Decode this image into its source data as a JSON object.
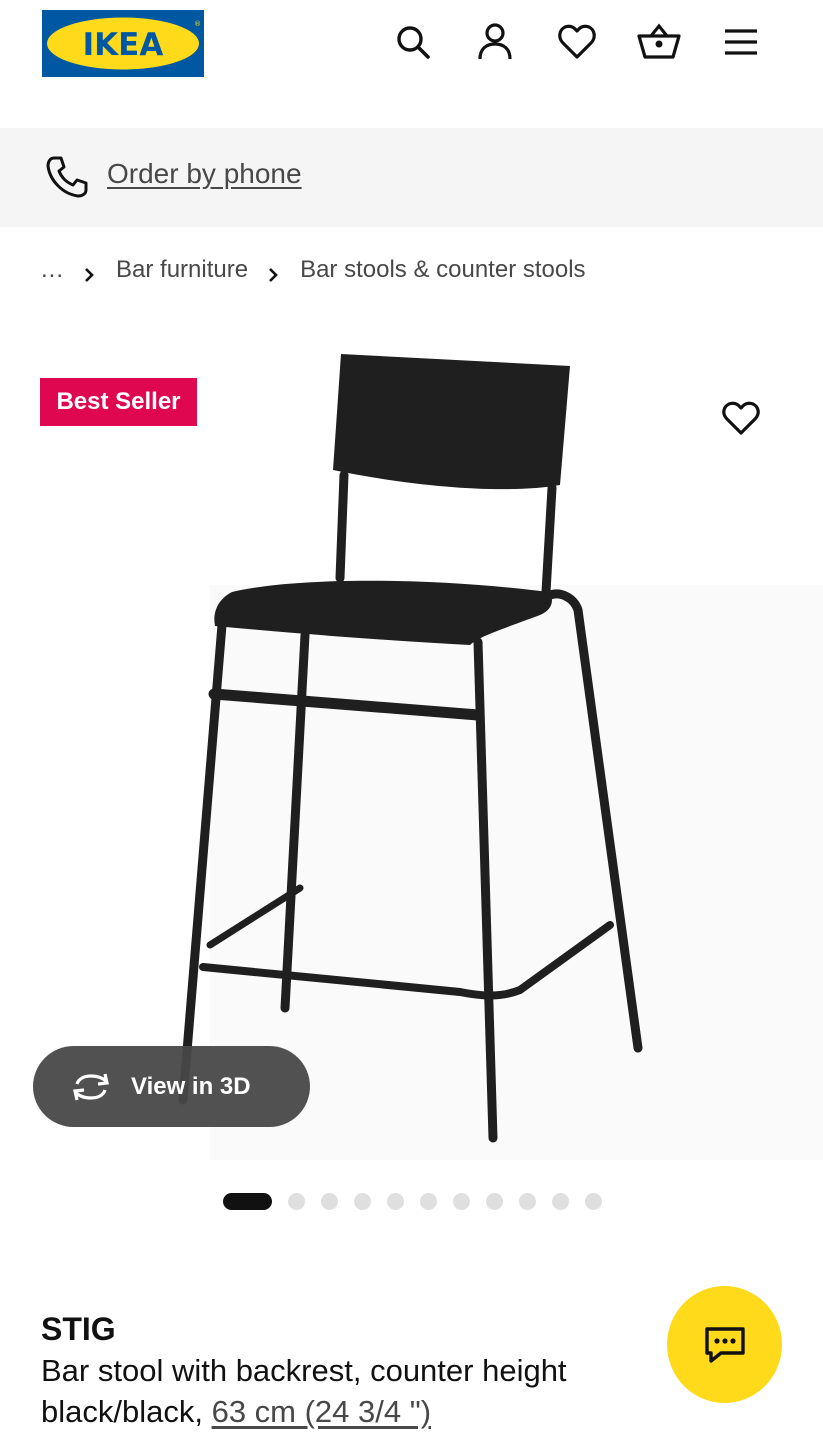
{
  "brand": {
    "logo_text": "IKEA",
    "colors": {
      "blue": "#0058a3",
      "yellow": "#ffda1a",
      "badge": "#e00751"
    }
  },
  "header": {
    "icons": [
      "search-icon",
      "account-icon",
      "favorites-icon",
      "cart-icon",
      "menu-icon"
    ]
  },
  "phone_bar": {
    "link_text": "Order by phone",
    "icon": "phone-icon"
  },
  "breadcrumb": {
    "items": [
      "...",
      "Bar furniture",
      "Bar stools & counter stools"
    ]
  },
  "product_image": {
    "badge": "Best Seller",
    "view_3d_label": "View in 3D",
    "pagination": {
      "total": 11,
      "active_index": 0
    }
  },
  "product": {
    "name": "STIG",
    "description": "Bar stool with backrest, counter height",
    "variant_prefix": "black/black, ",
    "size": "63 cm (24 3/4 \")"
  },
  "chat": {
    "icon": "chat-icon"
  }
}
